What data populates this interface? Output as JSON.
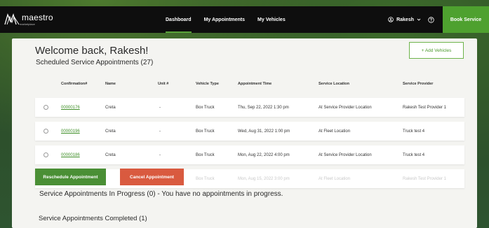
{
  "brand": {
    "name": "maestro",
    "tagline": "marketplace"
  },
  "nav": {
    "links": [
      "Dashboard",
      "My Appointments",
      "My Vehicles"
    ],
    "active": "Dashboard",
    "user_name": "Rakesh",
    "book_label": "Book Service"
  },
  "main": {
    "welcome": "Welcome back, Rakesh!",
    "scheduled_heading": "Scheduled Service Appointments (27)",
    "add_vehicles_label": "+ Add Vehicles",
    "table": {
      "headers": [
        "Confirmation#",
        "Name",
        "Unit #",
        "Vehicle Type",
        "Appointment Time",
        "Service Location",
        "Service Provider"
      ],
      "rows": [
        {
          "confirmation": "00000176",
          "name": "Creta",
          "unit": "-",
          "vehicle_type": "Box Truck",
          "time": "Thu, Sep 22, 2022 1:30 pm",
          "location": "At Service Provider Location",
          "provider": "Rakesh Test Provider 1"
        },
        {
          "confirmation": "00000196",
          "name": "Creta",
          "unit": "-",
          "vehicle_type": "Box Truck",
          "time": "Wed, Aug 31, 2022 1:00 pm",
          "location": "At Fleet Location",
          "provider": "Truck test 4"
        },
        {
          "confirmation": "00000186",
          "name": "Creta",
          "unit": "-",
          "vehicle_type": "Box Truck",
          "time": "Mon, Aug 22, 2022 4:00 pm",
          "location": "At Service Provider Location",
          "provider": "Truck test 4"
        },
        {
          "confirmation": "",
          "name": "",
          "unit": "",
          "vehicle_type": "Box Truck",
          "time": "Mon, Aug 15, 2022 3:00 pm",
          "location": "At Fleet Location",
          "provider": "Rakesh Test Provider 1"
        }
      ]
    },
    "reschedule_label": "Reschedule Appointment",
    "cancel_label": "Cancel Appointment",
    "in_progress_text": "Service Appointments In Progress (0) - You have no appointments in progress.",
    "completed_heading": "Service Appointments Completed (1)"
  },
  "colors": {
    "accent_green": "#4ea12f",
    "link_green": "#3f8f27",
    "cancel_red": "#d95a3f",
    "nav_bg": "#0e0e0e"
  },
  "icons": [
    "maestro-logo-icon",
    "user-icon",
    "chevron-down-icon",
    "help-icon"
  ]
}
